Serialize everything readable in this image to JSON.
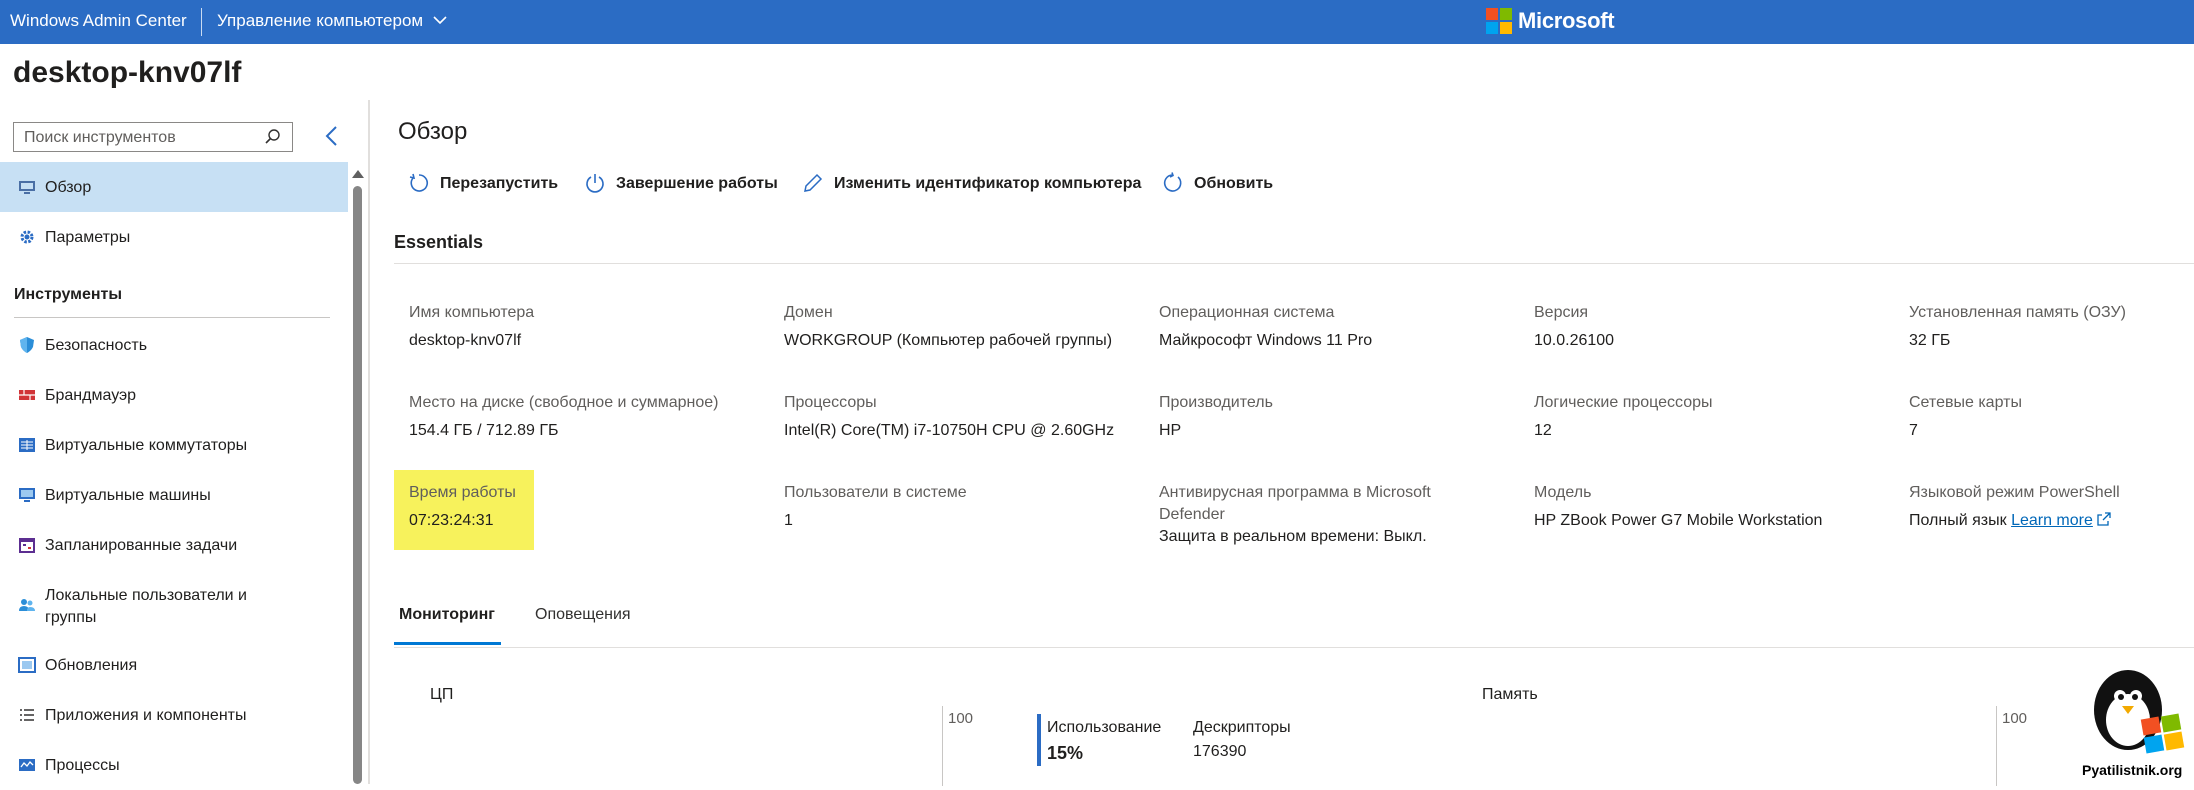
{
  "topbar": {
    "app_title": "Windows Admin Center",
    "mode_label": "Управление компьютером",
    "brand": "Microsoft",
    "logo_colors": [
      "#f25022",
      "#7fba00",
      "#00a4ef",
      "#ffb900"
    ],
    "bg_color": "#2b6cc4"
  },
  "host": {
    "name": "desktop-knv07lf"
  },
  "sidebar": {
    "search_placeholder": "Поиск инструментов",
    "items": [
      {
        "label": "Обзор",
        "icon": "overview-icon",
        "selected": true
      },
      {
        "label": "Параметры",
        "icon": "settings-gear-icon"
      }
    ],
    "section_label": "Инструменты",
    "tools": [
      {
        "label": "Безопасность",
        "icon": "shield-icon"
      },
      {
        "label": "Брандмауэр",
        "icon": "firewall-icon"
      },
      {
        "label": "Виртуальные коммутаторы",
        "icon": "virtual-switch-icon"
      },
      {
        "label": "Виртуальные машины",
        "icon": "virtual-machine-icon"
      },
      {
        "label": "Запланированные задачи",
        "icon": "scheduled-tasks-icon"
      },
      {
        "label": "Локальные пользователи и группы",
        "icon": "users-icon"
      },
      {
        "label": "Обновления",
        "icon": "updates-icon"
      },
      {
        "label": "Приложения и компоненты",
        "icon": "apps-icon"
      },
      {
        "label": "Процессы",
        "icon": "processes-icon"
      }
    ]
  },
  "main": {
    "title": "Обзор",
    "toolbar": {
      "restart": "Перезапустить",
      "shutdown": "Завершение работы",
      "rename": "Изменить идентификатор компьютера",
      "refresh": "Обновить"
    },
    "essentials_title": "Essentials",
    "properties": [
      {
        "label": "Имя компьютера",
        "value": "desktop-knv07lf"
      },
      {
        "label": "Домен",
        "value": "WORKGROUP (Компьютер рабочей группы)"
      },
      {
        "label": "Операционная система",
        "value": "Майкрософт Windows 11 Pro"
      },
      {
        "label": "Версия",
        "value": "10.0.26100"
      },
      {
        "label": "Установленная память (ОЗУ)",
        "value": "32 ГБ"
      },
      {
        "label": "Место на диске (свободное и суммарное)",
        "value": "154.4 ГБ / 712.89 ГБ"
      },
      {
        "label": "Процессоры",
        "value": "Intel(R) Core(TM) i7-10750H CPU @ 2.60GHz"
      },
      {
        "label": "Производитель",
        "value": "HP"
      },
      {
        "label": "Логические процессоры",
        "value": "12"
      },
      {
        "label": "Сетевые карты",
        "value": "7"
      },
      {
        "label": "Время работы",
        "value": "07:23:24:31"
      },
      {
        "label": "Пользователи в системе",
        "value": "1"
      },
      {
        "label": "Антивирусная программа в Microsoft Defender",
        "value": "Защита в реальном времени: Выкл."
      },
      {
        "label": "Модель",
        "value": "HP ZBook Power G7 Mobile Workstation"
      },
      {
        "label": "Языковой режим PowerShell",
        "value": "Полный язык",
        "link": "Learn more"
      }
    ],
    "tabs": [
      {
        "label": "Мониторинг",
        "active": true
      },
      {
        "label": "Оповещения",
        "active": false
      }
    ],
    "monitoring": {
      "cpu_title": "ЦП",
      "memory_title": "Память",
      "cpu_axis_max": "100",
      "mem_axis_max": "100",
      "usage_label": "Использование",
      "usage_value": "15%",
      "handles_label": "Дескрипторы",
      "handles_value": "176390"
    }
  },
  "watermark": {
    "text": "Pyatilistnik.org"
  }
}
